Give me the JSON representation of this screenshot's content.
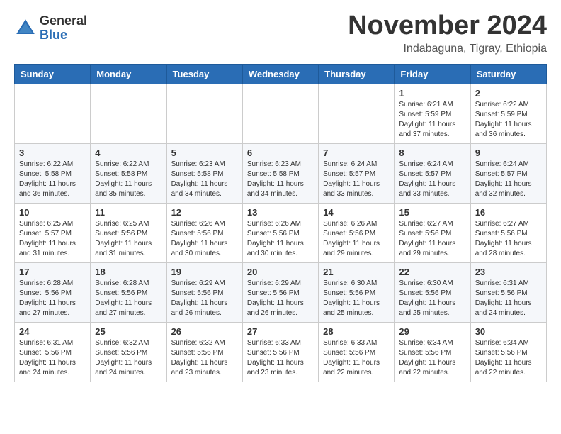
{
  "header": {
    "logo_general": "General",
    "logo_blue": "Blue",
    "month_title": "November 2024",
    "location": "Indabaguna, Tigray, Ethiopia"
  },
  "weekdays": [
    "Sunday",
    "Monday",
    "Tuesday",
    "Wednesday",
    "Thursday",
    "Friday",
    "Saturday"
  ],
  "weeks": [
    [
      {
        "day": "",
        "info": ""
      },
      {
        "day": "",
        "info": ""
      },
      {
        "day": "",
        "info": ""
      },
      {
        "day": "",
        "info": ""
      },
      {
        "day": "",
        "info": ""
      },
      {
        "day": "1",
        "info": "Sunrise: 6:21 AM\nSunset: 5:59 PM\nDaylight: 11 hours\nand 37 minutes."
      },
      {
        "day": "2",
        "info": "Sunrise: 6:22 AM\nSunset: 5:59 PM\nDaylight: 11 hours\nand 36 minutes."
      }
    ],
    [
      {
        "day": "3",
        "info": "Sunrise: 6:22 AM\nSunset: 5:58 PM\nDaylight: 11 hours\nand 36 minutes."
      },
      {
        "day": "4",
        "info": "Sunrise: 6:22 AM\nSunset: 5:58 PM\nDaylight: 11 hours\nand 35 minutes."
      },
      {
        "day": "5",
        "info": "Sunrise: 6:23 AM\nSunset: 5:58 PM\nDaylight: 11 hours\nand 34 minutes."
      },
      {
        "day": "6",
        "info": "Sunrise: 6:23 AM\nSunset: 5:58 PM\nDaylight: 11 hours\nand 34 minutes."
      },
      {
        "day": "7",
        "info": "Sunrise: 6:24 AM\nSunset: 5:57 PM\nDaylight: 11 hours\nand 33 minutes."
      },
      {
        "day": "8",
        "info": "Sunrise: 6:24 AM\nSunset: 5:57 PM\nDaylight: 11 hours\nand 33 minutes."
      },
      {
        "day": "9",
        "info": "Sunrise: 6:24 AM\nSunset: 5:57 PM\nDaylight: 11 hours\nand 32 minutes."
      }
    ],
    [
      {
        "day": "10",
        "info": "Sunrise: 6:25 AM\nSunset: 5:57 PM\nDaylight: 11 hours\nand 31 minutes."
      },
      {
        "day": "11",
        "info": "Sunrise: 6:25 AM\nSunset: 5:56 PM\nDaylight: 11 hours\nand 31 minutes."
      },
      {
        "day": "12",
        "info": "Sunrise: 6:26 AM\nSunset: 5:56 PM\nDaylight: 11 hours\nand 30 minutes."
      },
      {
        "day": "13",
        "info": "Sunrise: 6:26 AM\nSunset: 5:56 PM\nDaylight: 11 hours\nand 30 minutes."
      },
      {
        "day": "14",
        "info": "Sunrise: 6:26 AM\nSunset: 5:56 PM\nDaylight: 11 hours\nand 29 minutes."
      },
      {
        "day": "15",
        "info": "Sunrise: 6:27 AM\nSunset: 5:56 PM\nDaylight: 11 hours\nand 29 minutes."
      },
      {
        "day": "16",
        "info": "Sunrise: 6:27 AM\nSunset: 5:56 PM\nDaylight: 11 hours\nand 28 minutes."
      }
    ],
    [
      {
        "day": "17",
        "info": "Sunrise: 6:28 AM\nSunset: 5:56 PM\nDaylight: 11 hours\nand 27 minutes."
      },
      {
        "day": "18",
        "info": "Sunrise: 6:28 AM\nSunset: 5:56 PM\nDaylight: 11 hours\nand 27 minutes."
      },
      {
        "day": "19",
        "info": "Sunrise: 6:29 AM\nSunset: 5:56 PM\nDaylight: 11 hours\nand 26 minutes."
      },
      {
        "day": "20",
        "info": "Sunrise: 6:29 AM\nSunset: 5:56 PM\nDaylight: 11 hours\nand 26 minutes."
      },
      {
        "day": "21",
        "info": "Sunrise: 6:30 AM\nSunset: 5:56 PM\nDaylight: 11 hours\nand 25 minutes."
      },
      {
        "day": "22",
        "info": "Sunrise: 6:30 AM\nSunset: 5:56 PM\nDaylight: 11 hours\nand 25 minutes."
      },
      {
        "day": "23",
        "info": "Sunrise: 6:31 AM\nSunset: 5:56 PM\nDaylight: 11 hours\nand 24 minutes."
      }
    ],
    [
      {
        "day": "24",
        "info": "Sunrise: 6:31 AM\nSunset: 5:56 PM\nDaylight: 11 hours\nand 24 minutes."
      },
      {
        "day": "25",
        "info": "Sunrise: 6:32 AM\nSunset: 5:56 PM\nDaylight: 11 hours\nand 24 minutes."
      },
      {
        "day": "26",
        "info": "Sunrise: 6:32 AM\nSunset: 5:56 PM\nDaylight: 11 hours\nand 23 minutes."
      },
      {
        "day": "27",
        "info": "Sunrise: 6:33 AM\nSunset: 5:56 PM\nDaylight: 11 hours\nand 23 minutes."
      },
      {
        "day": "28",
        "info": "Sunrise: 6:33 AM\nSunset: 5:56 PM\nDaylight: 11 hours\nand 22 minutes."
      },
      {
        "day": "29",
        "info": "Sunrise: 6:34 AM\nSunset: 5:56 PM\nDaylight: 11 hours\nand 22 minutes."
      },
      {
        "day": "30",
        "info": "Sunrise: 6:34 AM\nSunset: 5:56 PM\nDaylight: 11 hours\nand 22 minutes."
      }
    ]
  ]
}
